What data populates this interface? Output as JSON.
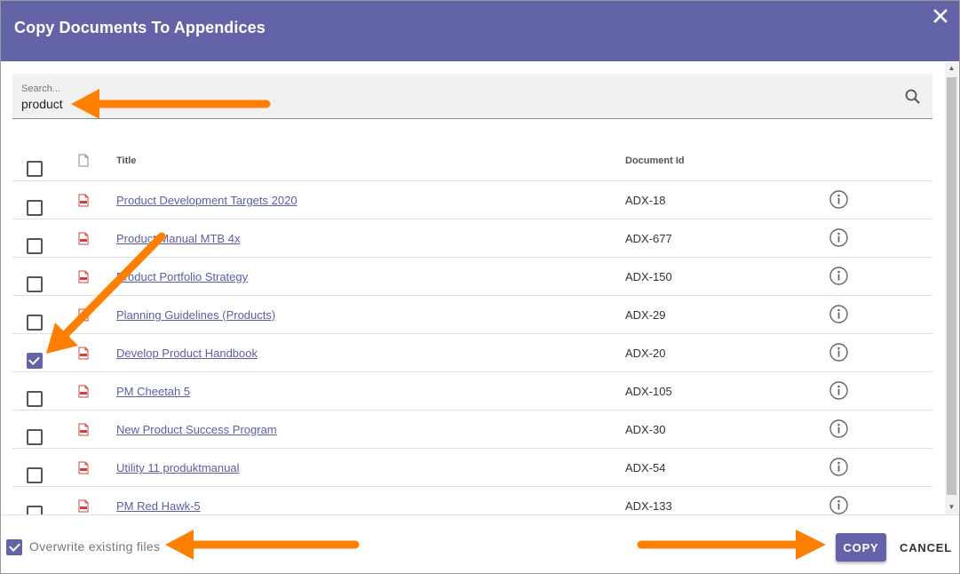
{
  "dialog": {
    "title": "Copy Documents To Appendices",
    "close_icon": "close-icon"
  },
  "search": {
    "label": "Search...",
    "value": "product",
    "icon": "search-icon"
  },
  "table": {
    "headers": {
      "title": "Title",
      "document_id": "Document Id"
    },
    "rows": [
      {
        "title": "Product Development Targets 2020",
        "id": "ADX-18",
        "checked": false
      },
      {
        "title": "Product Manual MTB 4x",
        "id": "ADX-677",
        "checked": false
      },
      {
        "title": "Product Portfolio Strategy",
        "id": "ADX-150",
        "checked": false
      },
      {
        "title": "Planning Guidelines (Products)",
        "id": "ADX-29",
        "checked": false
      },
      {
        "title": "Develop Product Handbook",
        "id": "ADX-20",
        "checked": true
      },
      {
        "title": "PM Cheetah 5",
        "id": "ADX-105",
        "checked": false
      },
      {
        "title": "New Product Success Program",
        "id": "ADX-30",
        "checked": false
      },
      {
        "title": "Utility 11 produktmanual",
        "id": "ADX-54",
        "checked": false
      },
      {
        "title": "PM Red Hawk-5",
        "id": "ADX-133",
        "checked": false
      }
    ]
  },
  "footer": {
    "overwrite_label": "Overwrite existing files",
    "overwrite_checked": true,
    "copy_label": "COPY",
    "cancel_label": "CANCEL"
  },
  "colors": {
    "header": "#6264a7",
    "accent": "#6264a7",
    "annotation_arrow": "#ff8000"
  }
}
